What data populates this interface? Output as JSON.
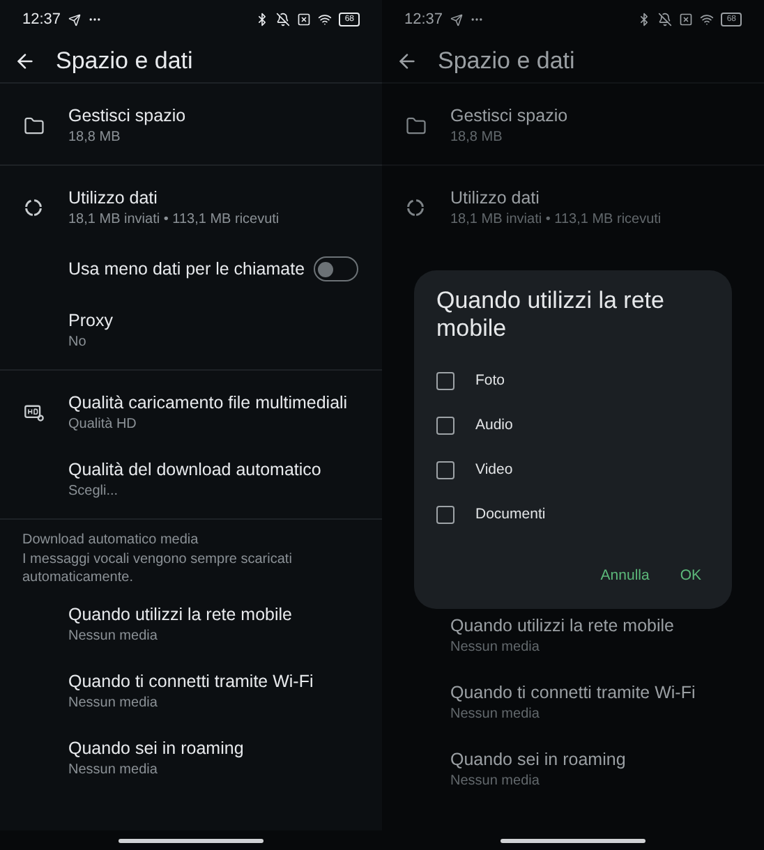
{
  "screens": [
    {
      "time": "12:37",
      "battery": "68",
      "title": "Spazio e dati",
      "dimmed": false,
      "sections": [
        {
          "kind": "list",
          "items": [
            {
              "kind": "storage",
              "title": "Gestisci spazio",
              "subtitle": "18,8 MB"
            }
          ]
        },
        {
          "kind": "list",
          "items": [
            {
              "kind": "usage",
              "title": "Utilizzo dati",
              "subtitle": "18,1 MB inviati • 113,1 MB ricevuti"
            },
            {
              "kind": "toggle",
              "title": "Usa meno dati per le chiamate",
              "on": false
            },
            {
              "kind": "row",
              "title": "Proxy",
              "subtitle": "No"
            }
          ]
        },
        {
          "kind": "list",
          "items": [
            {
              "kind": "quality",
              "title": "Qualità caricamento file multimediali",
              "subtitle": "Qualità HD"
            },
            {
              "kind": "row",
              "title": "Qualità del download automatico",
              "subtitle": "Scegli..."
            }
          ]
        },
        {
          "kind": "list",
          "header": "Download automatico media",
          "note": "I messaggi vocali vengono sempre scaricati automaticamente.",
          "items": [
            {
              "kind": "row",
              "title": "Quando utilizzi la rete mobile",
              "subtitle": "Nessun media"
            },
            {
              "kind": "row",
              "title": "Quando ti connetti tramite Wi-Fi",
              "subtitle": "Nessun media"
            },
            {
              "kind": "row",
              "title": "Quando sei in roaming",
              "subtitle": "Nessun media"
            }
          ]
        }
      ]
    },
    {
      "time": "12:37",
      "battery": "68",
      "title": "Spazio e dati",
      "dimmed": true,
      "sections": [
        {
          "kind": "list",
          "items": [
            {
              "kind": "storage",
              "title": "Gestisci spazio",
              "subtitle": "18,8 MB"
            }
          ]
        },
        {
          "kind": "list",
          "items": [
            {
              "kind": "usage",
              "title": "Utilizzo dati",
              "subtitle": "18,1 MB inviati • 113,1 MB ricevuti"
            }
          ]
        },
        {
          "kind": "dialog",
          "title": "Quando utilizzi la rete mobile",
          "options": [
            {
              "label": "Foto",
              "checked": false
            },
            {
              "label": "Audio",
              "checked": false
            },
            {
              "label": "Video",
              "checked": false
            },
            {
              "label": "Documenti",
              "checked": false
            }
          ],
          "buttons": [
            "Annulla",
            "OK"
          ]
        },
        {
          "kind": "list",
          "items": [
            {
              "kind": "row",
              "title": "Quando utilizzi la rete mobile",
              "subtitle": "Nessun media"
            },
            {
              "kind": "row",
              "title": "Quando ti connetti tramite Wi-Fi",
              "subtitle": "Nessun media"
            },
            {
              "kind": "row",
              "title": "Quando sei in roaming",
              "subtitle": "Nessun media"
            }
          ]
        }
      ]
    }
  ]
}
